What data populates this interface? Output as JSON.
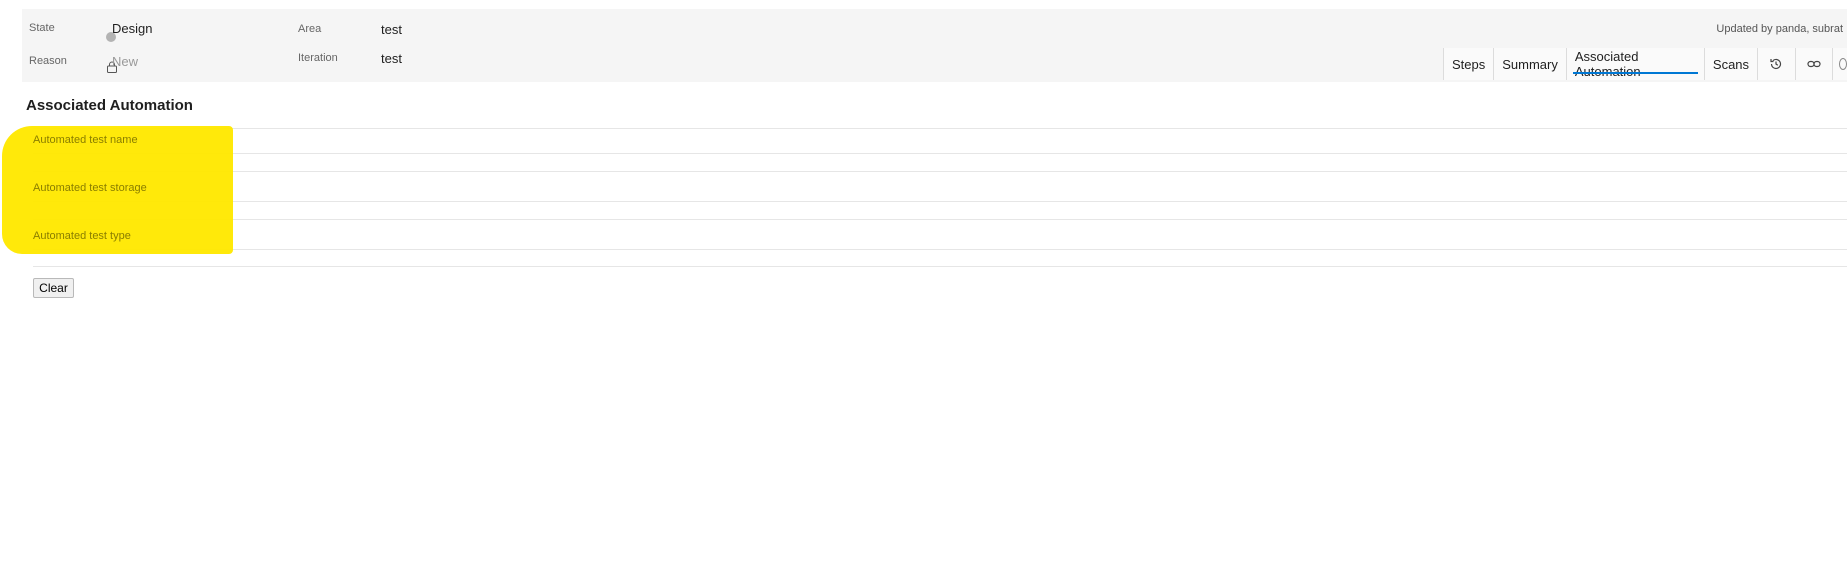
{
  "header": {
    "state_label": "State",
    "state_value": "Design",
    "reason_label": "Reason",
    "reason_value": "New",
    "area_label": "Area",
    "area_value": "test",
    "iteration_label": "Iteration",
    "iteration_value": "test",
    "updated_text": "Updated by panda, subrat"
  },
  "tabs": {
    "steps": "Steps",
    "summary": "Summary",
    "associated_automation": "Associated Automation",
    "scans": "Scans"
  },
  "section": {
    "title": "Associated Automation",
    "fields": {
      "name_label": "Automated test name",
      "storage_label": "Automated test storage",
      "type_label": "Automated test type"
    },
    "clear_label": "Clear"
  },
  "colors": {
    "highlight": "#ffe800",
    "tab_active_underline": "#0078d4",
    "header_bg": "#f5f5f5"
  },
  "icons": [
    "state-dot-icon",
    "lock-icon",
    "history-icon",
    "link-icon",
    "more-icon"
  ]
}
